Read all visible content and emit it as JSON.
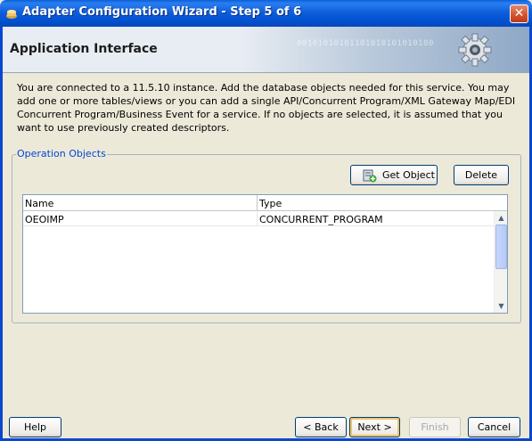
{
  "window": {
    "title": "Adapter Configuration Wizard - Step 5 of 6",
    "close_label": "✕"
  },
  "header": {
    "page_title": "Application Interface",
    "binary_text": "00101010101101010101010100"
  },
  "description": "You are connected to a 11.5.10 instance. Add the database objects needed for this service. You may add one or more tables/views or you can add a single API/Concurrent Program/XML Gateway Map/EDI Concurrent Program/Business Event for a service. If no objects are selected, it is assumed that you want to use previously created descriptors.",
  "operation_objects": {
    "legend": "Operation Objects",
    "get_object_label": "Get Object",
    "delete_label": "Delete",
    "table": {
      "columns": [
        "Name",
        "Type"
      ],
      "rows": [
        {
          "name": "OEOIMP",
          "type": "CONCURRENT_PROGRAM"
        }
      ]
    }
  },
  "footer": {
    "help_label": "Help",
    "back_label": "< Back",
    "next_label": "Next >",
    "finish_label": "Finish",
    "cancel_label": "Cancel"
  },
  "colors": {
    "title_bar": "#0054e3",
    "legend_text": "#0046d5",
    "dialog_bg": "#ece9d8"
  }
}
